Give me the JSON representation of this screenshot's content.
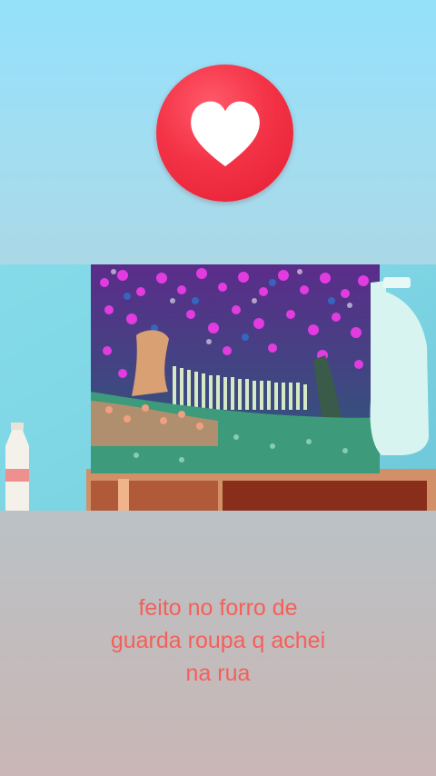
{
  "reaction": {
    "icon": "heart-icon",
    "color": "#f2283c"
  },
  "caption": {
    "lines": [
      "feito no forro de",
      "guarda roupa q achei",
      "na rua"
    ],
    "color": "#f4605a"
  },
  "photo": {
    "subject": "painting-photo"
  }
}
